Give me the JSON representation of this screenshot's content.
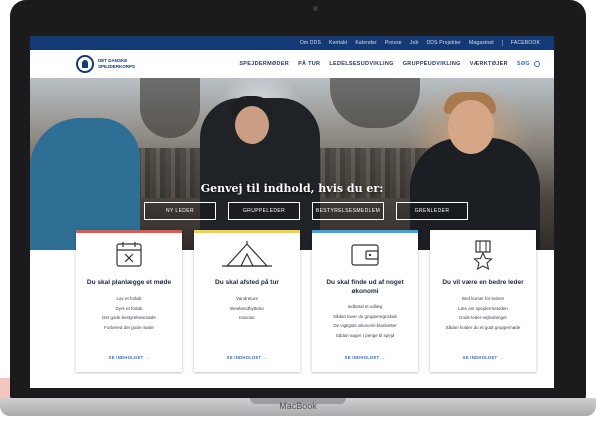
{
  "device": {
    "label": "MacBook"
  },
  "topbar": {
    "links": [
      "Om DDS",
      "Kontakt",
      "Kalender",
      "Presse",
      "Job",
      "DDS Projekter",
      "Magasinet",
      "FACEBOOK"
    ]
  },
  "header": {
    "logo_text": "DET DANSKE SPEJDERKORPS",
    "menu": [
      "SPEJDERMØDER",
      "PÅ TUR",
      "LEDELSESUDVIKLING",
      "GRUPPEUDVIKLING",
      "VÆRKTØJER"
    ],
    "search_label": "SØG"
  },
  "hero": {
    "title": "Genvej til indhold, hvis du er:",
    "buttons": [
      "NY LEDER",
      "GRUPPELEDER",
      "BESTYRELSESMEDLEM",
      "GRENLEDER"
    ]
  },
  "cards": [
    {
      "title": "Du skal planlægge et møde",
      "items": [
        "Lav et forløb",
        "Dyrk et forløb",
        "Det gode bestyrelsesmøde",
        "Forbered det gode møde"
      ],
      "more": "SE INDHOLDET →",
      "color": "#e5584f",
      "icon": "calendar-icon"
    },
    {
      "title": "Du skal afsted på tur",
      "items": [
        "Vandreture",
        "Weekendhyttetur",
        "Kanotur"
      ],
      "more": "SE INDHOLDET →",
      "color": "#f2d33b",
      "icon": "tent-icon"
    },
    {
      "title": "Du skal finde ud af noget økonomi",
      "items": [
        "Indbetal et udlæg",
        "Sådan laver du grupperegnskab",
        "De vigtigste økonomi-blanketter",
        "Sådan søger I penge til spejd"
      ],
      "more": "SE INDHOLDET →",
      "color": "#3aa6e0",
      "icon": "wallet-icon"
    },
    {
      "title": "Du vil være en bedre leder",
      "items": [
        "Bed kurser for ledere",
        "Læs om spejdermetoden",
        "Gode leder-vejledninger",
        "Sådan holder du et godt gruppemøde"
      ],
      "more": "SE INDHOLDET →",
      "color": "#ffffff",
      "icon": "medal-icon"
    }
  ]
}
